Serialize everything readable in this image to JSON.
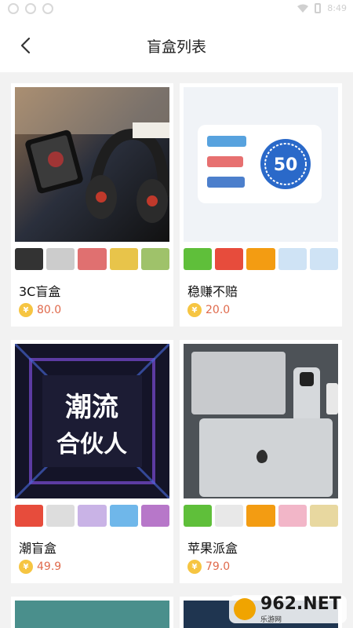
{
  "status_bar": {
    "time": "8:49"
  },
  "header": {
    "title": "盲盒列表"
  },
  "cards": [
    {
      "name": "3C盲盒",
      "price": "80.0",
      "cover": "headphones-on-desk"
    },
    {
      "name": "稳赚不赔",
      "price": "20.0",
      "cover": "phone-recharge-card",
      "cover_value": "50"
    },
    {
      "name": "潮盲盒",
      "price": "49.9",
      "cover": "trend-partner-poster",
      "cover_text": [
        "潮流",
        "合伙人"
      ]
    },
    {
      "name": "苹果派盒",
      "price": "79.0",
      "cover": "apple-products-flatlay"
    }
  ],
  "coin_symbol": "¥",
  "watermark": {
    "brand": "962.NET",
    "sub": "乐游网"
  }
}
